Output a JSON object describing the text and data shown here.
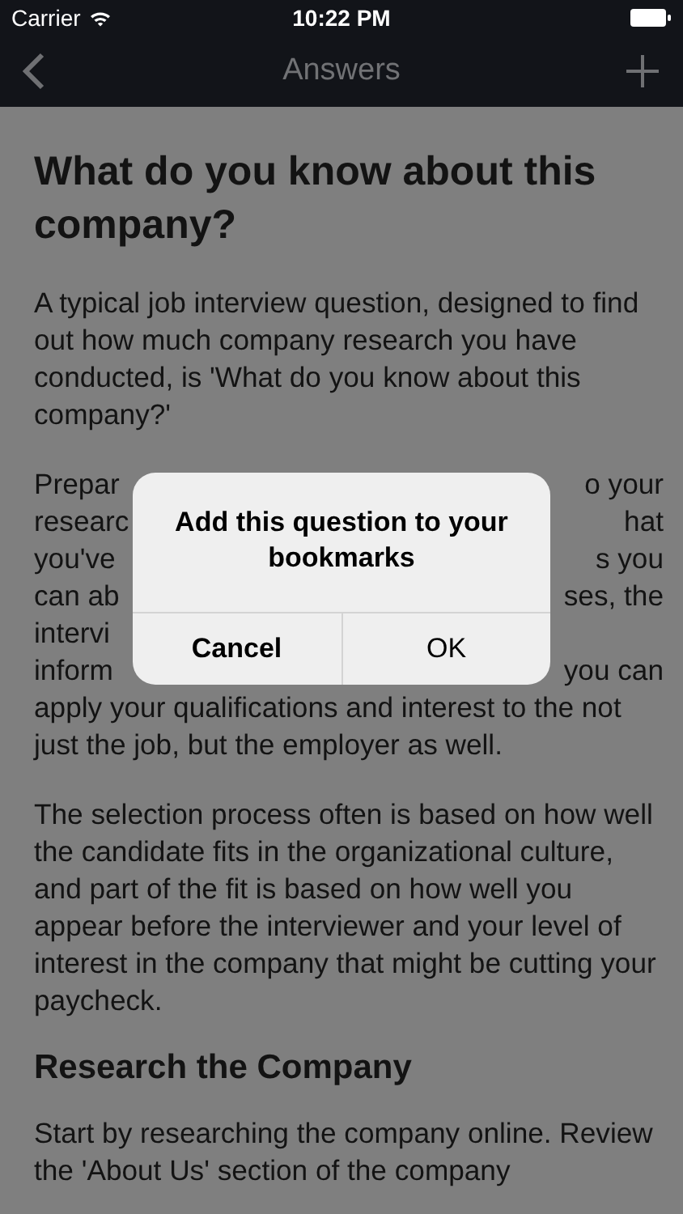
{
  "status_bar": {
    "carrier": "Carrier",
    "time": "10:22 PM"
  },
  "nav": {
    "title": "Answers"
  },
  "article": {
    "title": "What do you know about this company?",
    "intro": "A typical job interview question, designed to find out how much company research you have conducted, is 'What do you know about this company?'",
    "covered_lines": [
      {
        "left": "Prepar",
        "right": "o your"
      },
      {
        "left": "researc",
        "right": "hat"
      },
      {
        "left": "you've",
        "right": "s you"
      },
      {
        "left": "can ab",
        "right": "ses, the"
      },
      {
        "left": "intervi"
      },
      {
        "left": "inform",
        "right": "you can"
      }
    ],
    "after_dialog": "apply your qualifications and interest to the not just the job, but the employer as well.",
    "paragraph_2": "The selection process often is based on how well the candidate fits in the organizational culture, and part of the fit is based on how well you appear before the interviewer and your level of interest in the company that might be cutting your paycheck.",
    "subheading": "Research the Company",
    "paragraph_3": "Start by researching the company online. Review the 'About Us' section of the company"
  },
  "dialog": {
    "message": "Add this question to your bookmarks",
    "buttons": [
      {
        "label": "Cancel",
        "kind": "cancel"
      },
      {
        "label": "OK",
        "kind": "default"
      }
    ]
  }
}
